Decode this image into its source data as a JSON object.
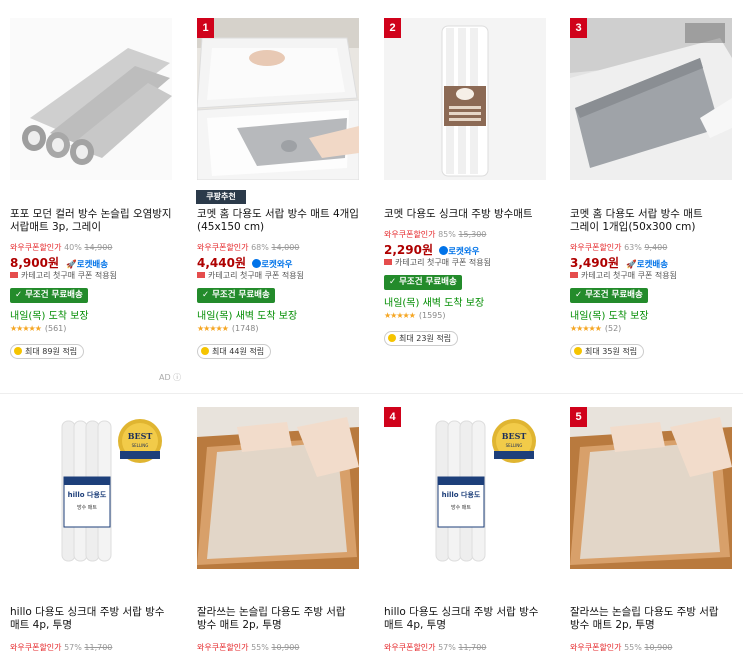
{
  "products": [
    {
      "rank": "",
      "badge": "",
      "title": "포포 모던 컬러 방수 논슬립 오염방지 서랍매트 3p, 그레이",
      "discount_label": "와우쿠폰할인가",
      "discount_rate": "40%",
      "original_price": "14,900",
      "price": "8,900원",
      "delivery_badge": "로켓배송",
      "coupon_text": "카테고리 첫구매 쿠폰 적용됨",
      "shipping": "✓ 무조건 무료배송",
      "arrival": "내일(목) 도착 보장",
      "stars": "★★★★★",
      "reviews": "(561)",
      "points": "최대 89원 적립"
    },
    {
      "rank": "1",
      "badge": "쿠팡추천",
      "title": "코멧 홈 다용도 서랍 방수 매트 4개입 (45x150 cm)",
      "discount_label": "와우쿠폰할인가",
      "discount_rate": "68%",
      "original_price": "14,000",
      "price": "4,440원",
      "delivery_badge": "로켓와우",
      "coupon_text": "카테고리 첫구매 쿠폰 적용됨",
      "shipping": "✓ 무조건 무료배송",
      "arrival": "내일(목) 새벽 도착 보장",
      "stars": "★★★★★",
      "reviews": "(1748)",
      "points": "최대 44원 적립"
    },
    {
      "rank": "2",
      "badge": "",
      "title": "코멧 다용도 싱크대 주방 방수매트",
      "discount_label": "와우쿠폰할인가",
      "discount_rate": "85%",
      "original_price": "15,300",
      "price": "2,290원",
      "delivery_badge": "로켓와우",
      "coupon_text": "카테고리 첫구매 쿠폰 적용됨",
      "shipping": "✓ 무조건 무료배송",
      "arrival": "내일(목) 새벽 도착 보장",
      "stars": "★★★★★",
      "reviews": "(1595)",
      "points": "최대 23원 적립"
    },
    {
      "rank": "3",
      "badge": "",
      "title": "코멧 홈 다용도 서랍 방수 매트 그레이 1개입(50x300 cm)",
      "discount_label": "와우쿠폰할인가",
      "discount_rate": "63%",
      "original_price": "9,400",
      "price": "3,490원",
      "delivery_badge": "로켓배송",
      "coupon_text": "카테고리 첫구매 쿠폰 적용됨",
      "shipping": "✓ 무조건 무료배송",
      "arrival": "내일(목) 도착 보장",
      "stars": "★★★★★",
      "reviews": "(52)",
      "points": "최대 35원 적립"
    },
    {
      "rank": "",
      "title": "hillo 다용도 싱크대 주방 서랍 방수 매트 4p, 투명",
      "discount_label": "와우쿠폰할인가",
      "discount_rate": "57%",
      "original_price": "11,700"
    },
    {
      "rank": "",
      "title": "잘라쓰는 논슬립 다용도 주방 서랍 방수 매트 2p, 투명",
      "discount_label": "와우쿠폰할인가",
      "discount_rate": "55%",
      "original_price": "10,900"
    },
    {
      "rank": "4",
      "title": "hillo 다용도 싱크대 주방 서랍 방수 매트 4p, 투명",
      "discount_label": "와우쿠폰할인가",
      "discount_rate": "57%",
      "original_price": "11,700"
    },
    {
      "rank": "5",
      "title": "잘라쓰는 논슬립 다용도 주방 서랍 방수 매트 2p, 투명",
      "discount_label": "와우쿠폰할인가",
      "discount_rate": "55%",
      "original_price": "10,900"
    }
  ],
  "best_badge": {
    "top": "BEST",
    "bottom": "SELLING"
  },
  "hillo_box": {
    "brand": "hillo",
    "name": "hillo 다용도",
    "sub": "방수 매트"
  },
  "ad_label": "AD ⓘ",
  "colors": {
    "price": "#ae0000",
    "rocket": "#0073e9",
    "ship_green": "#238b2b",
    "rank_red": "#d0021b"
  }
}
